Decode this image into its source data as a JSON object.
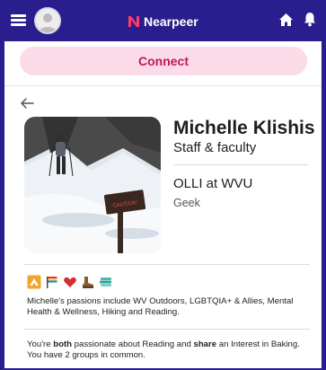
{
  "header": {
    "brand": "Nearpeer",
    "menu_icon": "hamburger-menu-icon",
    "home_icon": "home-icon",
    "notifications_icon": "bell-icon"
  },
  "actions": {
    "connect_label": "Connect"
  },
  "profile": {
    "name": "Michelle Klishis",
    "role": "Staff & faculty",
    "organization": "OLLI at WVU",
    "persona": "Geek",
    "photo_sign_text": "CAUTION"
  },
  "badges": [
    "outdoors-badge-icon",
    "flag-badge-icon",
    "heart-badge-icon",
    "hiking-boot-badge-icon",
    "book-stack-badge-icon"
  ],
  "passions_text": "Michelle's passions include WV Outdoors, LGBTQIA+ & Allies, Mental Health & Wellness, Hiking and Reading.",
  "common": {
    "part1": "You're ",
    "both": "both",
    "part2": " passionate about Reading and ",
    "share": "share",
    "part3": " an Interest in Baking. You have 2 groups in common."
  },
  "colors": {
    "header_bg": "#2a1e8f",
    "connect_bg": "#fadbe7",
    "connect_text": "#c2185b"
  }
}
